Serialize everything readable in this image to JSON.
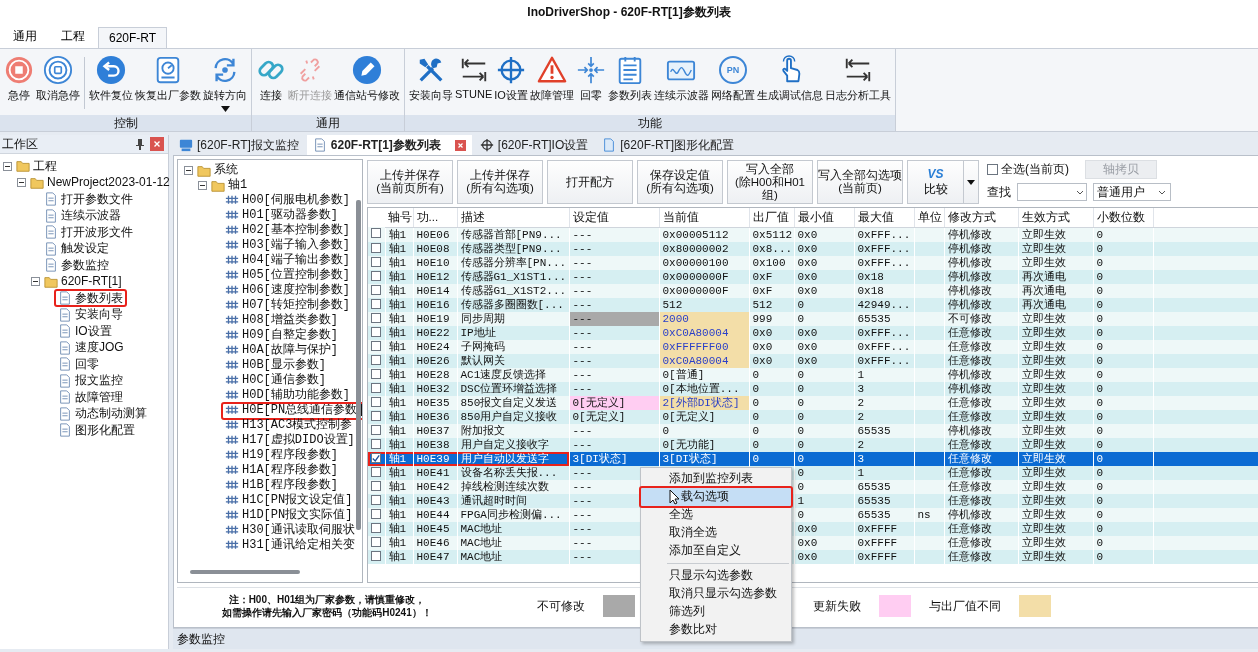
{
  "window": {
    "title": "InoDriverShop - 620F-RT[1]参数列表"
  },
  "ribbon_tabs": [
    {
      "label": "通用",
      "selected": false
    },
    {
      "label": "工程",
      "selected": false
    },
    {
      "label": "620F-RT",
      "selected": true
    }
  ],
  "ribbon_groups": [
    {
      "title": "控制",
      "buttons": [
        {
          "label": "急停",
          "disabled": false
        },
        {
          "label": "取消急停",
          "disabled": false
        },
        {
          "label": "软件复位",
          "disabled": false,
          "separator_before": true
        },
        {
          "label": "恢复出厂参数",
          "disabled": false
        },
        {
          "label": "旋转方向",
          "disabled": false,
          "dropdown": true
        }
      ]
    },
    {
      "title": "通用",
      "buttons": [
        {
          "label": "连接",
          "disabled": false
        },
        {
          "label": "断开连接",
          "disabled": true
        },
        {
          "label": "通信站号修改",
          "disabled": false
        }
      ]
    },
    {
      "title": "功能",
      "buttons": [
        {
          "label": "安装向导",
          "disabled": false
        },
        {
          "label": "STUNE",
          "disabled": false
        },
        {
          "label": "IO设置",
          "disabled": false
        },
        {
          "label": "故障管理",
          "disabled": false
        },
        {
          "label": "回零",
          "disabled": false
        },
        {
          "label": "参数列表",
          "disabled": false
        },
        {
          "label": "连续示波器",
          "disabled": false
        },
        {
          "label": "网络配置",
          "disabled": false,
          "badge": "PN"
        },
        {
          "label": "生成调试信息",
          "disabled": false
        },
        {
          "label": "日志分析工具",
          "disabled": false
        }
      ]
    }
  ],
  "workspace": {
    "title": "工作区",
    "tree": [
      {
        "label": "工程",
        "expanded": true,
        "annotated": false,
        "children": [
          {
            "label": "NewProject2023-01-12",
            "expanded": true,
            "annotated": false,
            "children": [
              {
                "label": "打开参数文件",
                "annotated": false
              },
              {
                "label": "连续示波器",
                "annotated": false
              },
              {
                "label": "打开波形文件",
                "annotated": false
              },
              {
                "label": "触发设定",
                "annotated": false
              },
              {
                "label": "参数监控",
                "annotated": false
              },
              {
                "label": "620F-RT[1]",
                "expanded": true,
                "annotated": false,
                "children": [
                  {
                    "label": "参数列表",
                    "annotated": true
                  },
                  {
                    "label": "安装向导",
                    "annotated": false
                  },
                  {
                    "label": "IO设置",
                    "annotated": false
                  },
                  {
                    "label": "速度JOG",
                    "annotated": false
                  },
                  {
                    "label": "回零",
                    "annotated": false
                  },
                  {
                    "label": "报文监控",
                    "annotated": false
                  },
                  {
                    "label": "故障管理",
                    "annotated": false
                  },
                  {
                    "label": "动态制动测算",
                    "annotated": false
                  },
                  {
                    "label": "图形化配置",
                    "annotated": false
                  }
                ]
              }
            ]
          }
        ]
      }
    ]
  },
  "doc_tabs": [
    {
      "label": "[620F-RT]报文监控",
      "selected": false
    },
    {
      "label": "620F-RT[1]参数列表",
      "selected": true,
      "closable": true
    },
    {
      "label": "[620F-RT]IO设置",
      "selected": false
    },
    {
      "label": "[620F-RT]图形化配置",
      "selected": false
    }
  ],
  "param_tree": [
    {
      "label": "系统",
      "expanded": true,
      "annotated": false,
      "children": [
        {
          "label": "轴1",
          "expanded": true,
          "annotated": false,
          "children": [
            {
              "label": "H00[伺服电机参数]",
              "annotated": false
            },
            {
              "label": "H01[驱动器参数]",
              "annotated": false
            },
            {
              "label": "H02[基本控制参数]",
              "annotated": false
            },
            {
              "label": "H03[端子输入参数]",
              "annotated": false
            },
            {
              "label": "H04[端子输出参数]",
              "annotated": false
            },
            {
              "label": "H05[位置控制参数]",
              "annotated": false
            },
            {
              "label": "H06[速度控制参数]",
              "annotated": false
            },
            {
              "label": "H07[转矩控制参数]",
              "annotated": false
            },
            {
              "label": "H08[增益类参数]",
              "annotated": false
            },
            {
              "label": "H09[自整定参数]",
              "annotated": false
            },
            {
              "label": "H0A[故障与保护]",
              "annotated": false
            },
            {
              "label": "H0B[显示参数]",
              "annotated": false
            },
            {
              "label": "H0C[通信参数]",
              "annotated": false
            },
            {
              "label": "H0D[辅助功能参数]",
              "annotated": false
            },
            {
              "label": "H0E[PN总线通信参数]",
              "annotated": true
            },
            {
              "label": "H13[AC3模式控制参",
              "annotated": false
            },
            {
              "label": "H17[虚拟DIDO设置]",
              "annotated": false
            },
            {
              "label": "H19[程序段参数]",
              "annotated": false
            },
            {
              "label": "H1A[程序段参数]",
              "annotated": false
            },
            {
              "label": "H1B[程序段参数]",
              "annotated": false
            },
            {
              "label": "H1C[PN报文设定值]",
              "annotated": false
            },
            {
              "label": "H1D[PN报文实际值]",
              "annotated": false
            },
            {
              "label": "H30[通讯读取伺服状",
              "annotated": false
            },
            {
              "label": "H31[通讯给定相关变",
              "annotated": false
            }
          ]
        }
      ]
    }
  ],
  "actions": [
    {
      "label": "上传并保存\n(当前页所有)"
    },
    {
      "label": "上传并保存\n(所有勾选项)"
    },
    {
      "label": "打开配方"
    },
    {
      "label": "保存设定值\n(所有勾选项)"
    },
    {
      "label": "写入全部\n(除H00和H01组)"
    },
    {
      "label": "写入全部勾选项\n(当前页)"
    },
    {
      "label": "比较",
      "badge": "VS",
      "dropdown": true
    }
  ],
  "select_all": {
    "label": "全选(当前页)",
    "checked": false
  },
  "axis_copy": {
    "label": "轴拷贝",
    "disabled": true
  },
  "search": {
    "label": "查找"
  },
  "user_level": {
    "value": "普通用户"
  },
  "table": {
    "columns": [
      "轴号",
      "功...",
      "描述",
      "设定值",
      "当前值",
      "出厂值",
      "最小值",
      "最大值",
      "单位",
      "修改方式",
      "生效方式",
      "小数位数"
    ],
    "rows": [
      {
        "checked": false,
        "selected": false,
        "annotated": false,
        "setting_locked": false,
        "setting_failed": false,
        "current_changed": false,
        "cells": [
          "轴1",
          "H0E06",
          "传感器首部[PN9...",
          "---",
          "0x00005112",
          "0x5112",
          "0x0",
          "0xFFF...",
          "",
          "停机修改",
          "立即生效",
          "0"
        ]
      },
      {
        "checked": false,
        "selected": false,
        "annotated": false,
        "setting_locked": false,
        "setting_failed": false,
        "current_changed": false,
        "cells": [
          "轴1",
          "H0E08",
          "传感器类型[PN9...",
          "---",
          "0x80000002",
          "0x8...",
          "0x0",
          "0xFFF...",
          "",
          "停机修改",
          "立即生效",
          "0"
        ]
      },
      {
        "checked": false,
        "selected": false,
        "annotated": false,
        "setting_locked": false,
        "setting_failed": false,
        "current_changed": false,
        "cells": [
          "轴1",
          "H0E10",
          "传感器分辨率[PN...",
          "---",
          "0x00000100",
          "0x100",
          "0x0",
          "0xFFF...",
          "",
          "停机修改",
          "立即生效",
          "0"
        ]
      },
      {
        "checked": false,
        "selected": false,
        "annotated": false,
        "setting_locked": false,
        "setting_failed": false,
        "current_changed": false,
        "cells": [
          "轴1",
          "H0E12",
          "传感器G1_X1ST1...",
          "---",
          "0x0000000F",
          "0xF",
          "0x0",
          "0x18",
          "",
          "停机修改",
          "再次通电",
          "0"
        ]
      },
      {
        "checked": false,
        "selected": false,
        "annotated": false,
        "setting_locked": false,
        "setting_failed": false,
        "current_changed": false,
        "cells": [
          "轴1",
          "H0E14",
          "传感器G1_X1ST2...",
          "---",
          "0x0000000F",
          "0xF",
          "0x0",
          "0x18",
          "",
          "停机修改",
          "再次通电",
          "0"
        ]
      },
      {
        "checked": false,
        "selected": false,
        "annotated": false,
        "setting_locked": false,
        "setting_failed": false,
        "current_changed": false,
        "cells": [
          "轴1",
          "H0E16",
          "传感器多圈圈数[...",
          "---",
          "512",
          "512",
          "0",
          "42949...",
          "",
          "停机修改",
          "再次通电",
          "0"
        ]
      },
      {
        "checked": false,
        "selected": false,
        "annotated": false,
        "setting_locked": true,
        "setting_failed": false,
        "current_changed": true,
        "cells": [
          "轴1",
          "H0E19",
          "同步周期",
          "---",
          "2000",
          "999",
          "0",
          "65535",
          "",
          "不可修改",
          "立即生效",
          "0"
        ]
      },
      {
        "checked": false,
        "selected": false,
        "annotated": false,
        "setting_locked": false,
        "setting_failed": false,
        "current_changed": true,
        "cells": [
          "轴1",
          "H0E22",
          "IP地址",
          "---",
          "0xC0A80004",
          "0x0",
          "0x0",
          "0xFFF...",
          "",
          "任意修改",
          "立即生效",
          "0"
        ]
      },
      {
        "checked": false,
        "selected": false,
        "annotated": false,
        "setting_locked": false,
        "setting_failed": false,
        "current_changed": true,
        "cells": [
          "轴1",
          "H0E24",
          "子网掩码",
          "---",
          "0xFFFFFF00",
          "0x0",
          "0x0",
          "0xFFF...",
          "",
          "任意修改",
          "立即生效",
          "0"
        ]
      },
      {
        "checked": false,
        "selected": false,
        "annotated": false,
        "setting_locked": false,
        "setting_failed": false,
        "current_changed": true,
        "cells": [
          "轴1",
          "H0E26",
          "默认网关",
          "---",
          "0xC0A80004",
          "0x0",
          "0x0",
          "0xFFF...",
          "",
          "任意修改",
          "立即生效",
          "0"
        ]
      },
      {
        "checked": false,
        "selected": false,
        "annotated": false,
        "setting_locked": false,
        "setting_failed": false,
        "current_changed": false,
        "cells": [
          "轴1",
          "H0E28",
          "AC1速度反馈选择",
          "---",
          "0[普通]",
          "0",
          "0",
          "1",
          "",
          "停机修改",
          "立即生效",
          "0"
        ]
      },
      {
        "checked": false,
        "selected": false,
        "annotated": false,
        "setting_locked": false,
        "setting_failed": false,
        "current_changed": false,
        "cells": [
          "轴1",
          "H0E32",
          "DSC位置环增益选择",
          "---",
          "0[本地位置...",
          "0",
          "0",
          "3",
          "",
          "停机修改",
          "立即生效",
          "0"
        ]
      },
      {
        "checked": false,
        "selected": false,
        "annotated": false,
        "setting_locked": false,
        "setting_failed": true,
        "current_changed": true,
        "cells": [
          "轴1",
          "H0E35",
          "850报文自定义发送",
          "0[无定义]",
          "2[外部DI状态]",
          "0",
          "0",
          "2",
          "",
          "任意修改",
          "立即生效",
          "0"
        ]
      },
      {
        "checked": false,
        "selected": false,
        "annotated": false,
        "setting_locked": false,
        "setting_failed": false,
        "current_changed": false,
        "cells": [
          "轴1",
          "H0E36",
          "850用户自定义接收",
          "0[无定义]",
          "0[无定义]",
          "0",
          "0",
          "2",
          "",
          "任意修改",
          "立即生效",
          "0"
        ]
      },
      {
        "checked": false,
        "selected": false,
        "annotated": false,
        "setting_locked": false,
        "setting_failed": false,
        "current_changed": false,
        "cells": [
          "轴1",
          "H0E37",
          "附加报文",
          "---",
          "0",
          "0",
          "0",
          "65535",
          "",
          "停机修改",
          "立即生效",
          "0"
        ]
      },
      {
        "checked": false,
        "selected": false,
        "annotated": false,
        "setting_locked": false,
        "setting_failed": false,
        "current_changed": false,
        "cells": [
          "轴1",
          "H0E38",
          "用户自定义接收字",
          "---",
          "0[无功能]",
          "0",
          "0",
          "2",
          "",
          "任意修改",
          "立即生效",
          "0"
        ]
      },
      {
        "checked": true,
        "selected": true,
        "annotated": true,
        "setting_locked": false,
        "setting_failed": false,
        "current_changed": false,
        "cells": [
          "轴1",
          "H0E39",
          "用户自动以发送字",
          "3[DI状态]",
          "3[DI状态]",
          "0",
          "0",
          "3",
          "",
          "任意修改",
          "立即生效",
          "0"
        ]
      },
      {
        "checked": false,
        "selected": false,
        "annotated": false,
        "setting_locked": false,
        "setting_failed": false,
        "cells": [
          "轴1",
          "H0E41",
          "设备名称丢失报...",
          "---",
          "",
          "",
          "0",
          "1",
          "",
          "任意修改",
          "立即生效",
          "0"
        ]
      },
      {
        "checked": false,
        "selected": false,
        "annotated": false,
        "setting_locked": false,
        "setting_failed": false,
        "cells": [
          "轴1",
          "H0E42",
          "掉线检测连续次数",
          "---",
          "",
          "",
          "0",
          "65535",
          "",
          "任意修改",
          "立即生效",
          "0"
        ]
      },
      {
        "checked": false,
        "selected": false,
        "annotated": false,
        "setting_locked": false,
        "setting_failed": false,
        "cells": [
          "轴1",
          "H0E43",
          "通讯超时时间",
          "---",
          "",
          "",
          "1",
          "65535",
          "",
          "任意修改",
          "立即生效",
          "0"
        ]
      },
      {
        "checked": false,
        "selected": false,
        "annotated": false,
        "setting_locked": false,
        "setting_failed": false,
        "cells": [
          "轴1",
          "H0E44",
          "FPGA同步检测偏...",
          "---",
          "",
          "",
          "0",
          "65535",
          "ns",
          "停机修改",
          "立即生效",
          "0"
        ]
      },
      {
        "checked": false,
        "selected": false,
        "annotated": false,
        "setting_locked": false,
        "setting_failed": false,
        "cells": [
          "轴1",
          "H0E45",
          "MAC地址",
          "---",
          "",
          "",
          "0x0",
          "0xFFFF",
          "",
          "任意修改",
          "立即生效",
          "0"
        ]
      },
      {
        "checked": false,
        "selected": false,
        "annotated": false,
        "setting_locked": false,
        "setting_failed": false,
        "cells": [
          "轴1",
          "H0E46",
          "MAC地址",
          "---",
          "",
          "",
          "0x0",
          "0xFFFF",
          "",
          "任意修改",
          "立即生效",
          "0"
        ]
      },
      {
        "checked": false,
        "selected": false,
        "annotated": false,
        "setting_locked": false,
        "setting_failed": false,
        "cells": [
          "轴1",
          "H0E47",
          "MAC地址",
          "---",
          "",
          "",
          "0x0",
          "0xFFFF",
          "",
          "任意修改",
          "立即生效",
          "0"
        ]
      }
    ]
  },
  "note_lines": [
    "注：H00、H01组为厂家参数，请慎重修改，",
    "如需操作请先输入厂家密码（功能码H0241）！"
  ],
  "legend": [
    {
      "label": "不可修改",
      "color": "#a9a9a9"
    },
    {
      "label": "更新失败",
      "color": "#ffcdf2"
    },
    {
      "label": "与出厂值不同",
      "color": "#f3dea8"
    }
  ],
  "context_menu": {
    "items": [
      {
        "kind": "item",
        "label": "添加到监控列表",
        "hovered": false,
        "annotated": false
      },
      {
        "kind": "item",
        "label": "载勾选项",
        "hovered": true,
        "annotated": true
      },
      {
        "kind": "item",
        "label": "全选",
        "hovered": false,
        "annotated": false
      },
      {
        "kind": "item",
        "label": "取消全选",
        "hovered": false,
        "annotated": false
      },
      {
        "kind": "item",
        "label": "添加至自定义",
        "hovered": false,
        "annotated": false
      },
      {
        "kind": "separator"
      },
      {
        "kind": "item",
        "label": "只显示勾选参数",
        "hovered": false,
        "annotated": false
      },
      {
        "kind": "item",
        "label": "取消只显示勾选参数",
        "hovered": false,
        "annotated": false
      },
      {
        "kind": "item",
        "label": "筛选列",
        "hovered": false,
        "annotated": false
      },
      {
        "kind": "item",
        "label": "参数比对",
        "hovered": false,
        "annotated": false
      }
    ]
  },
  "bottom_panel": {
    "title": "参数监控"
  }
}
